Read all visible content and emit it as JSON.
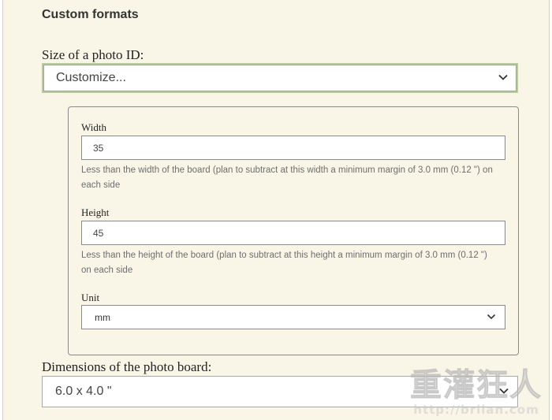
{
  "section": {
    "title": "Custom formats"
  },
  "photo_id": {
    "label": "Size of a photo ID:",
    "selected": "Customize..."
  },
  "custom_panel": {
    "width": {
      "label": "Width",
      "value": "35",
      "help": "Less than the width of the board (plan to subtract at this width a minimum margin of 3.0 mm (0.12 \") on each side"
    },
    "height": {
      "label": "Height",
      "value": "45",
      "help": "Less than the height of the board (plan to subtract at this height a minimum margin of 3.0 mm (0.12 \") on each side"
    },
    "unit": {
      "label": "Unit",
      "selected": "mm"
    }
  },
  "board": {
    "label": "Dimensions of the photo board:",
    "selected": "6.0 x 4.0 \""
  },
  "watermark": {
    "logo": "重灌狂人",
    "url": "http://briian.com"
  },
  "icons": {
    "select_chevron": "chevron-down-icon"
  }
}
